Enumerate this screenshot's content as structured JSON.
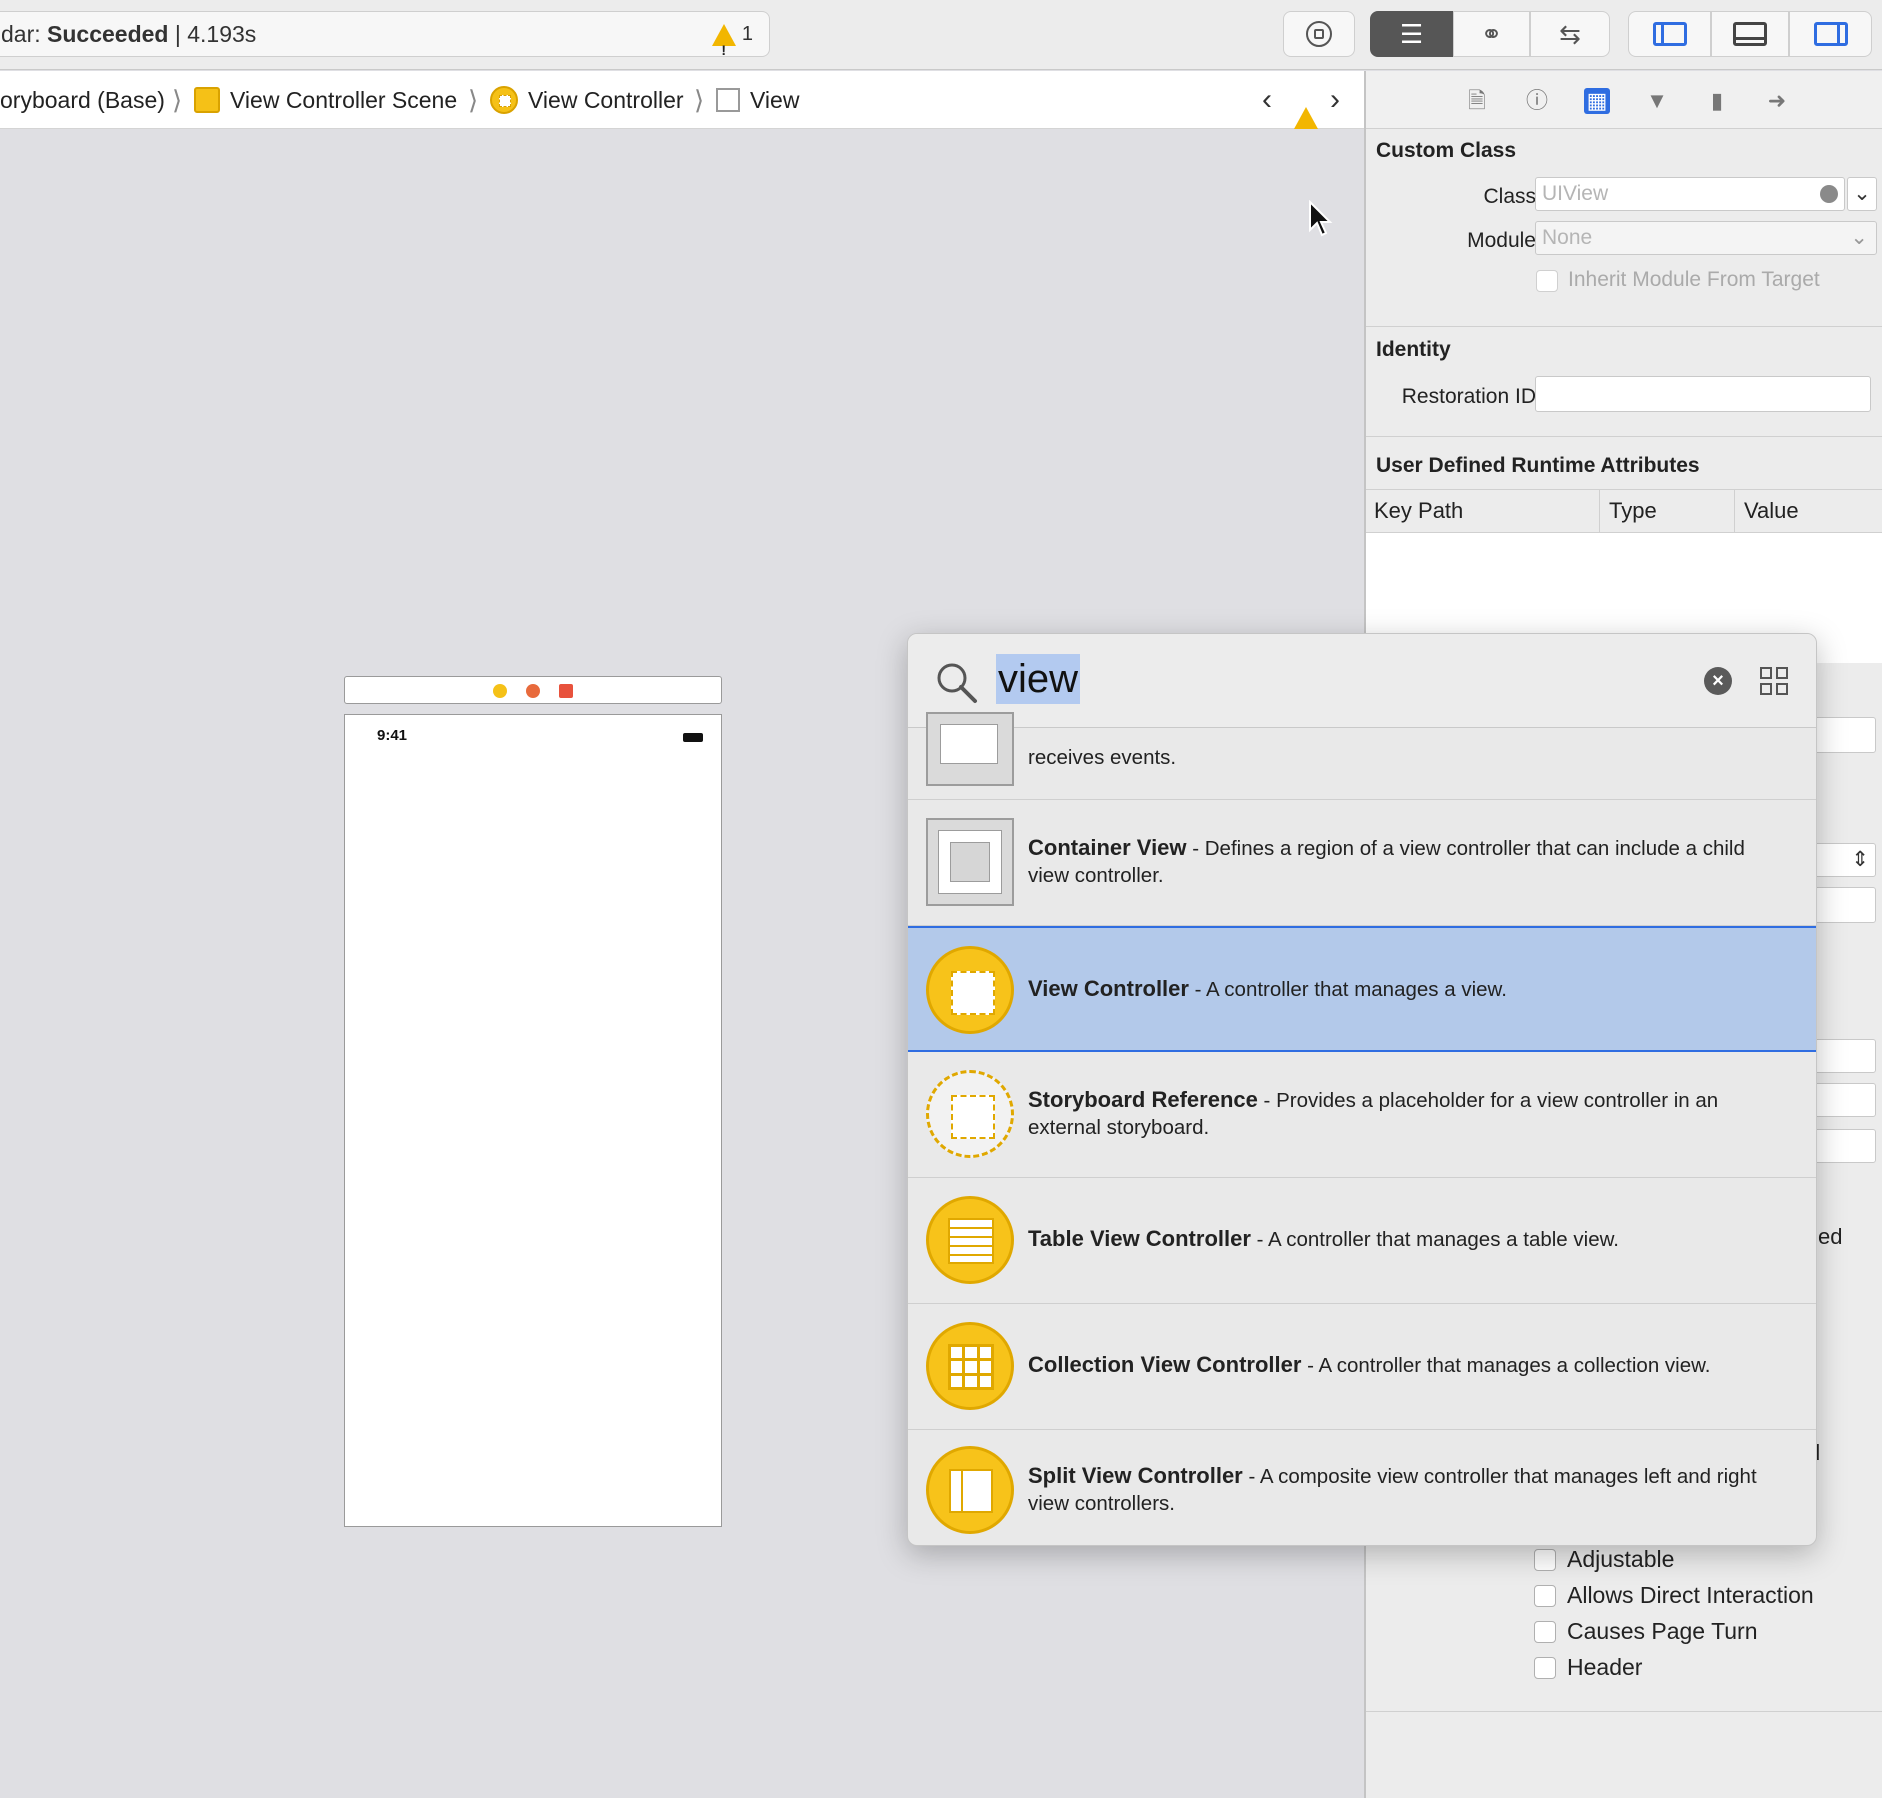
{
  "toolbar": {
    "activity_prefix": "dar:",
    "activity_status": "Succeeded",
    "activity_time": "| 4.193s",
    "warning_count": "1"
  },
  "breadcrumb": {
    "items": [
      "oryboard (Base)",
      "View Controller Scene",
      "View Controller",
      "View"
    ]
  },
  "canvas": {
    "status_time": "9:41"
  },
  "inspector": {
    "custom_class": {
      "title": "Custom Class",
      "class_label": "Class",
      "class_placeholder": "UIView",
      "module_label": "Module",
      "module_placeholder": "None",
      "inherit_label": "Inherit Module From Target"
    },
    "identity": {
      "title": "Identity",
      "restoration_label": "Restoration ID"
    },
    "runtime_attrs": {
      "title": "User Defined Runtime Attributes",
      "columns": [
        "Key Path",
        "Type",
        "Value"
      ]
    },
    "partial_texts": [
      "ed",
      "d"
    ],
    "traits": [
      "Adjustable",
      "Allows Direct Interaction",
      "Causes Page Turn",
      "Header"
    ]
  },
  "library": {
    "search_value": "view",
    "items": [
      {
        "name": "",
        "desc": "receives events."
      },
      {
        "name": "Container View",
        "desc": " - Defines a region of a view controller that can include a child view controller."
      },
      {
        "name": "View Controller",
        "desc": " - A controller that manages a view."
      },
      {
        "name": "Storyboard Reference",
        "desc": " - Provides a placeholder for a view controller in an external storyboard."
      },
      {
        "name": "Table View Controller",
        "desc": " - A controller that manages a table view."
      },
      {
        "name": "Collection View Controller",
        "desc": " - A controller that manages a collection view."
      },
      {
        "name": "Split View Controller",
        "desc": " - A composite view controller that manages left and right view controllers."
      }
    ]
  },
  "colors": {
    "accent": "#2f6de1",
    "selection": "#b3c9ea",
    "warning": "#f2b600",
    "object_yellow": "#f7c31a"
  }
}
